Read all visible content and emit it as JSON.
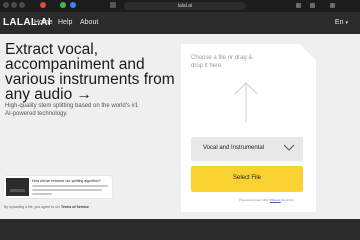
{
  "browser": {
    "url": "lalal.ai",
    "colors": {
      "close": "#e04a3f",
      "green": "#3fb950",
      "blue": "#3b82f6"
    }
  },
  "header": {
    "logo": "LALAL.AI",
    "nav": [
      "Home",
      "Help",
      "About"
    ],
    "language": "En"
  },
  "hero": {
    "title": "Extract vocal, accompaniment and various instruments from any audio →",
    "subtitle": "High-quality stem splitting based on the world's #1 AI-powered technology."
  },
  "promo": {
    "title": "How did we enhance our splitting algorithm?"
  },
  "terms": {
    "text": "By uploading a file, you agree to our",
    "link": "Terms of Service"
  },
  "upload": {
    "drop_hint": "Choose a file or drag & drop it here",
    "stem_option": "Vocal and Instrumental",
    "select_button": "Select File",
    "privacy": {
      "prefix": "Processing level:",
      "mid": "MAX",
      "link": "Phoenix",
      "suffix": "Algorithm"
    }
  }
}
